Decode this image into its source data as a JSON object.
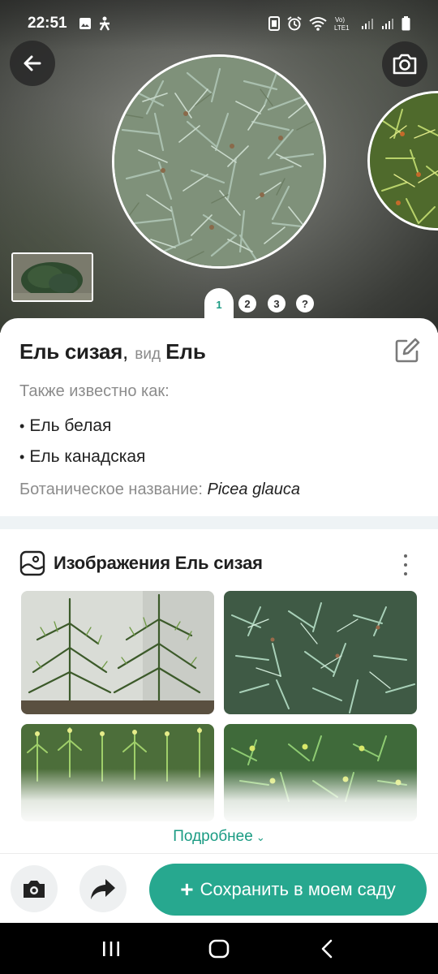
{
  "status_bar": {
    "time": "22:51",
    "left_icons": [
      "gallery-icon",
      "accessibility-icon"
    ],
    "right_icons": [
      "nfc-icon",
      "alarm-icon",
      "wifi-icon",
      "volte-icon",
      "signal-icon",
      "signal-icon",
      "battery-icon"
    ],
    "volte_label": "Vo)\nLTE1"
  },
  "hero": {
    "pager": [
      "1",
      "2",
      "3",
      "?"
    ],
    "active_page": "1"
  },
  "plant": {
    "name": "Ель сизая",
    "genus_prefix": "вид",
    "genus": "Ель",
    "also_known_label": "Также известно как:",
    "aliases": [
      "Ель белая",
      "Ель канадская"
    ],
    "botanical_label": "Ботаническое название:",
    "botanical_name": "Picea glauca"
  },
  "images_section": {
    "title": "Изображения Ель сизая",
    "details_link": "Подробнее"
  },
  "actions": {
    "save_label": "Сохранить в моем саду"
  },
  "colors": {
    "accent": "#27a88f",
    "link": "#1a9b83",
    "separator": "#eef3f5"
  }
}
